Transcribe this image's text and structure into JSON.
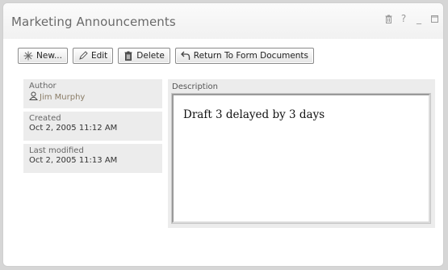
{
  "portlet": {
    "title": "Marketing Announcements",
    "controls": [
      "trash-icon",
      "help-icon",
      "minimize-icon",
      "maximize-icon"
    ],
    "help_label": "?",
    "minimize_label": "_"
  },
  "toolbar": {
    "new_label": "New...",
    "edit_label": "Edit",
    "delete_label": "Delete",
    "return_label": "Return To Form Documents"
  },
  "meta": {
    "author_label": "Author",
    "author_value": "Jim Murphy",
    "created_label": "Created",
    "created_value": "Oct 2, 2005 11:12 AM",
    "modified_label": "Last modified",
    "modified_value": "Oct 2, 2005 11:13 AM"
  },
  "description": {
    "label": "Description",
    "text": "Draft 3 delayed by 3 days"
  }
}
